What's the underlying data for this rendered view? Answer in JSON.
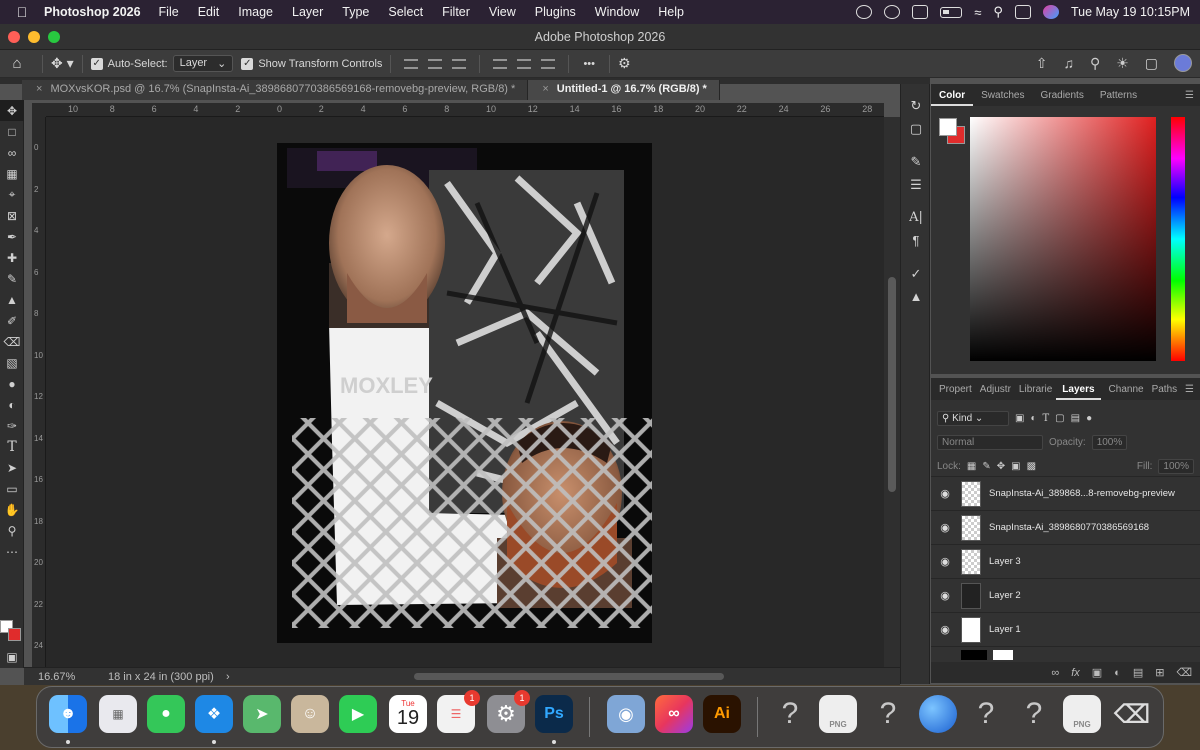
{
  "menubar": {
    "app_name": "Photoshop 2026",
    "menus": [
      "File",
      "Edit",
      "Image",
      "Layer",
      "Type",
      "Select",
      "Filter",
      "View",
      "Plugins",
      "Window",
      "Help"
    ],
    "datetime": "Tue May 19  10:15PM"
  },
  "window": {
    "title": "Adobe Photoshop 2026"
  },
  "options": {
    "auto_select_label": "Auto-Select:",
    "auto_select_value": "Layer",
    "transform_label": "Show Transform Controls",
    "more_label": "•••"
  },
  "tabs": [
    {
      "label": "MOXvsKOR.psd @ 16.7% (SnapInsta-Ai_3898680770386569168-removebg-preview, RGB/8) *",
      "close": "×"
    },
    {
      "label": "Untitled-1 @ 16.7% (RGB/8) *",
      "close": "×"
    }
  ],
  "ruler": {
    "h_labels": [
      "10",
      "8",
      "6",
      "4",
      "2",
      "0",
      "2",
      "4",
      "6",
      "8",
      "10",
      "12",
      "14",
      "16",
      "18",
      "20",
      "22",
      "24",
      "26",
      "28"
    ],
    "v_labels": [
      "0",
      "2",
      "4",
      "6",
      "8",
      "10",
      "12",
      "14",
      "16",
      "18",
      "20",
      "22",
      "24"
    ]
  },
  "status": {
    "zoom": "16.67%",
    "doc_size": "18 in x 24 in (300 ppi)",
    "arrow": "›"
  },
  "color_panel": {
    "tabs": [
      "Color",
      "Swatches",
      "Gradients",
      "Patterns"
    ],
    "fg": "#ffffff",
    "bg": "#e02c2c"
  },
  "layers_panel": {
    "tabs": [
      "Propert",
      "Adjustr",
      "Librarie",
      "Layers",
      "Channe",
      "Paths"
    ],
    "kind_label": "Kind",
    "blend_mode": "Normal",
    "opacity_label": "Opacity:",
    "opacity_value": "100%",
    "lock_label": "Lock:",
    "fill_label": "Fill:",
    "fill_value": "100%",
    "layers": [
      {
        "name": "SnapInsta-Ai_389868...8-removebg-preview"
      },
      {
        "name": "SnapInsta-Ai_3898680770386569168"
      },
      {
        "name": "Layer 3"
      },
      {
        "name": "Layer 2"
      },
      {
        "name": "Layer 1"
      }
    ]
  },
  "dock": {
    "apps": [
      {
        "name": "Finder",
        "color": "#2a8ef0"
      },
      {
        "name": "Launchpad",
        "color": "#e6e6e6"
      },
      {
        "name": "Messages",
        "color": "#34c759"
      },
      {
        "name": "Safari",
        "color": "#1e88e5"
      },
      {
        "name": "Maps",
        "color": "#59b86d"
      },
      {
        "name": "Contacts",
        "color": "#c9b79c"
      },
      {
        "name": "FaceTime",
        "color": "#2ecc55"
      },
      {
        "name": "Calendar",
        "color": "#ffffff"
      },
      {
        "name": "Reminders",
        "color": "#f2f2f2"
      },
      {
        "name": "System Settings",
        "color": "#8e8e93"
      },
      {
        "name": "Photoshop",
        "color": "#0b2a4a"
      },
      {
        "name": "Creative Cloud",
        "color": "#e8365d"
      },
      {
        "name": "Illustrator",
        "color": "#2a1200"
      }
    ],
    "calendar_day": "Tue",
    "calendar_date": "19",
    "reminders_badge": "1",
    "settings_badge": "1",
    "ps_label": "Ps",
    "ai_label": "Ai",
    "png_label": "PNG",
    "question_mark": "?"
  }
}
